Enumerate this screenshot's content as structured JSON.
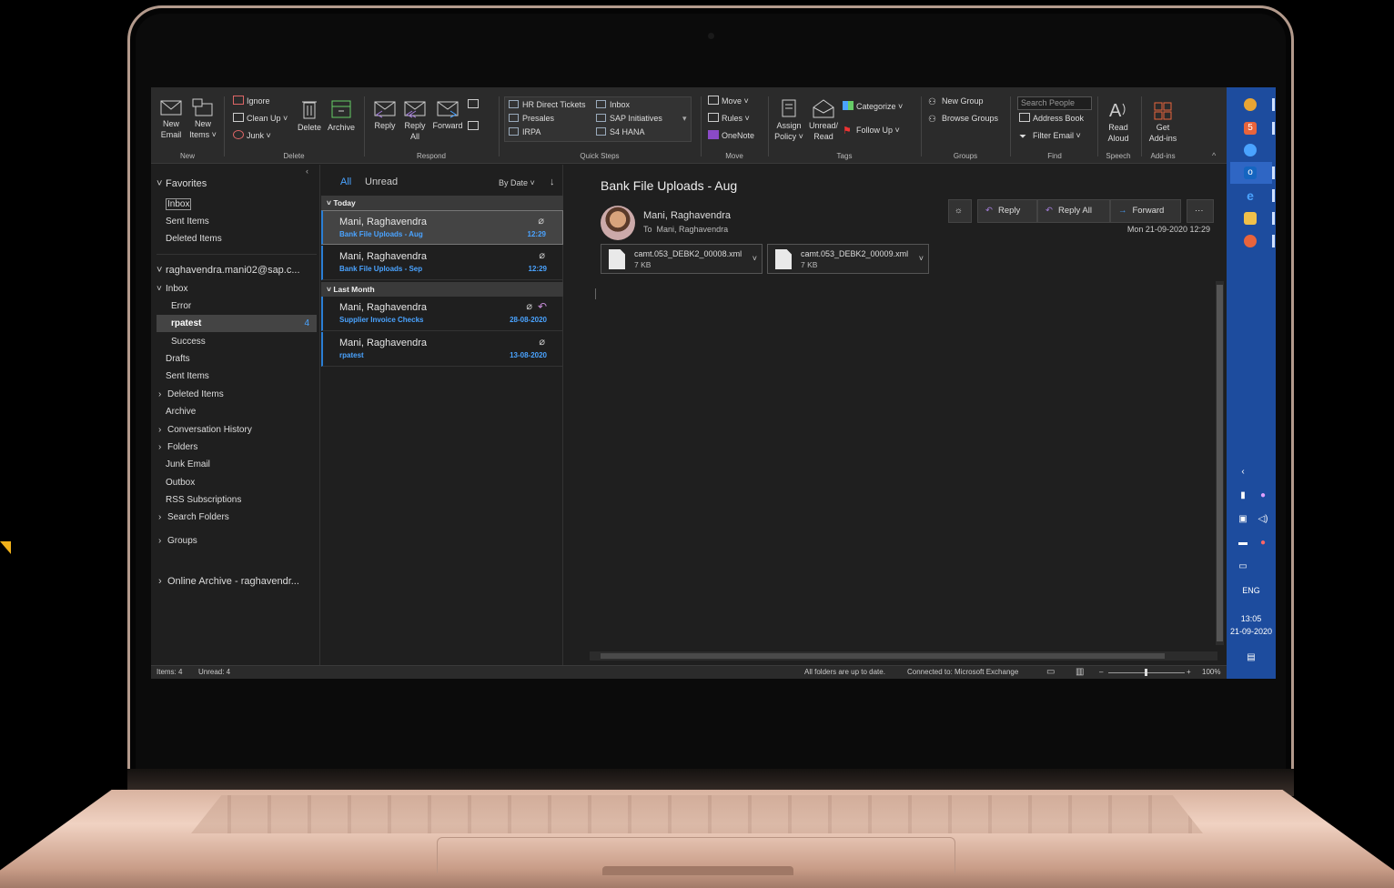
{
  "ribbon": {
    "groups": {
      "new": "New",
      "delete": "Delete",
      "respond": "Respond",
      "quick_steps": "Quick Steps",
      "move": "Move",
      "tags": "Tags",
      "groups": "Groups",
      "find": "Find",
      "speech": "Speech",
      "add_ins": "Add-ins"
    },
    "new_email": [
      "New",
      "Email"
    ],
    "new_items": [
      "New",
      "Items ˅"
    ],
    "ignore": "Ignore",
    "clean_up": "Clean Up ˅",
    "junk": "Junk ˅",
    "delete": "Delete",
    "archive": "Archive",
    "reply": "Reply",
    "reply_all": [
      "Reply",
      "All"
    ],
    "forward": "Forward",
    "quick_steps": [
      "HR Direct Tickets",
      "Inbox",
      "Presales",
      "SAP Initiatives",
      "IRPA",
      "S4 HANA"
    ],
    "move_btn": "Move ˅",
    "rules": "Rules ˅",
    "onenote": "OneNote",
    "assign_policy": [
      "Assign",
      "Policy ˅"
    ],
    "unread_read": [
      "Unread/",
      "Read"
    ],
    "categorize": "Categorize ˅",
    "follow_up": "Follow Up ˅",
    "new_group": "New Group",
    "browse_groups": "Browse Groups",
    "search_people": "Search People",
    "address_book": "Address Book",
    "filter_email": "Filter Email ˅",
    "read_aloud": [
      "Read",
      "Aloud"
    ],
    "get_addins": [
      "Get",
      "Add-ins"
    ]
  },
  "folders": {
    "favorites": "Favorites",
    "fav_items": [
      "Inbox",
      "Sent Items",
      "Deleted Items"
    ],
    "account": "raghavendra.mani02@sap.c...",
    "inbox": "Inbox",
    "error": "Error",
    "rpatest": "rpatest",
    "rpatest_count": "4",
    "success": "Success",
    "drafts": "Drafts",
    "sent_items": "Sent Items",
    "deleted_items": "Deleted Items",
    "archive": "Archive",
    "conversation_history": "Conversation History",
    "folders": "Folders",
    "junk_email": "Junk Email",
    "outbox": "Outbox",
    "rss": "RSS Subscriptions",
    "search_folders": "Search Folders",
    "groups": "Groups",
    "online_archive": "Online Archive - raghavendr..."
  },
  "list": {
    "all": "All",
    "unread": "Unread",
    "sort": "By Date ˅",
    "sort_dir": "↓",
    "groups": [
      "Today",
      "Last Month"
    ],
    "messages": [
      {
        "from": "Mani, Raghavendra",
        "subject": "Bank File Uploads - Aug",
        "time": "12:29"
      },
      {
        "from": "Mani, Raghavendra",
        "subject": "Bank File Uploads - Sep",
        "time": "12:29"
      },
      {
        "from": "Mani, Raghavendra",
        "subject": "Supplier Invoice Checks",
        "time": "28-08-2020"
      },
      {
        "from": "Mani, Raghavendra",
        "subject": "rpatest",
        "time": "13-08-2020"
      }
    ]
  },
  "reading": {
    "subject": "Bank File Uploads - Aug",
    "sender": "Mani, Raghavendra",
    "to_label": "To",
    "to": "Mani, Raghavendra",
    "date": "Mon 21-09-2020 12:29",
    "reply": "Reply",
    "reply_all": "Reply All",
    "forward": "Forward",
    "more": "···",
    "attachments": [
      {
        "name": "camt.053_DEBK2_00008.xml",
        "size": "7 KB"
      },
      {
        "name": "camt.053_DEBK2_00009.xml",
        "size": "7 KB"
      }
    ]
  },
  "status": {
    "items": "Items: 4",
    "unread": "Unread: 4",
    "uptodate": "All folders are up to date.",
    "connected": "Connected to: Microsoft Exchange",
    "zoom": "100%",
    "zoom_level": 1.0
  },
  "taskbar": {
    "lang": "ENG",
    "time": "13:05",
    "date": "21-09-2020"
  },
  "colors": {
    "accent": "#4aa3ff",
    "taskbar": "#1d4c9e",
    "ribbon": "#2b2b2b",
    "background": "#1f1f1f"
  }
}
